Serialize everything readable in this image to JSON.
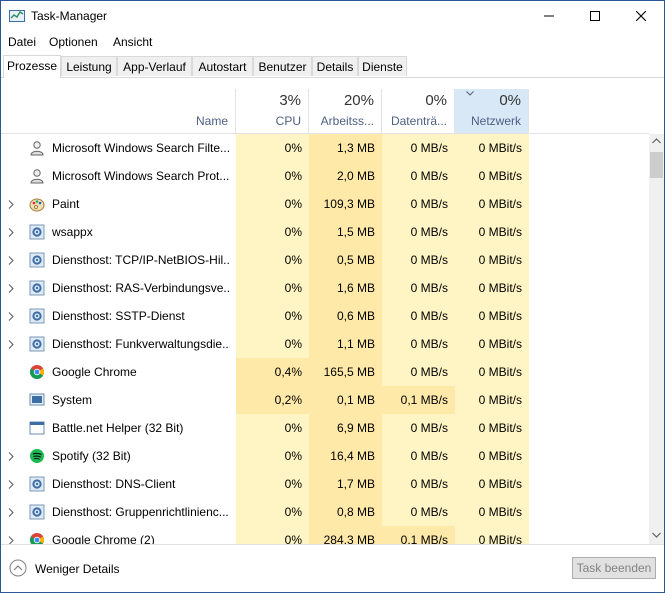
{
  "window": {
    "title": "Task-Manager"
  },
  "menu": [
    "Datei",
    "Optionen",
    "Ansicht"
  ],
  "tabs": [
    "Prozesse",
    "Leistung",
    "App-Verlauf",
    "Autostart",
    "Benutzer",
    "Details",
    "Dienste"
  ],
  "active_tab": "Prozesse",
  "columns": {
    "name": {
      "label": "Name"
    },
    "cpu": {
      "pct": "3%",
      "label": "CPU"
    },
    "mem": {
      "pct": "20%",
      "label": "Arbeitss..."
    },
    "disk": {
      "pct": "0%",
      "label": "Datenträ..."
    },
    "net": {
      "pct": "0%",
      "label": "Netzwerk"
    }
  },
  "rows": [
    {
      "name": "Microsoft Windows Search Filte...",
      "icon": "search-service-icon",
      "expandable": false,
      "cpu": "0%",
      "mem": "1,3 MB",
      "disk": "0 MB/s",
      "net": "0 MBit/s"
    },
    {
      "name": "Microsoft Windows Search Prot...",
      "icon": "search-service-icon",
      "expandable": false,
      "cpu": "0%",
      "mem": "2,0 MB",
      "disk": "0 MB/s",
      "net": "0 MBit/s"
    },
    {
      "name": "Paint",
      "icon": "paint-icon",
      "expandable": true,
      "cpu": "0%",
      "mem": "109,3 MB",
      "disk": "0 MB/s",
      "net": "0 MBit/s"
    },
    {
      "name": "wsappx",
      "icon": "gear-icon",
      "expandable": true,
      "cpu": "0%",
      "mem": "1,5 MB",
      "disk": "0 MB/s",
      "net": "0 MBit/s"
    },
    {
      "name": "Diensthost: TCP/IP-NetBIOS-Hil...",
      "icon": "gear-icon",
      "expandable": true,
      "cpu": "0%",
      "mem": "0,5 MB",
      "disk": "0 MB/s",
      "net": "0 MBit/s"
    },
    {
      "name": "Diensthost: RAS-Verbindungsve...",
      "icon": "gear-icon",
      "expandable": true,
      "cpu": "0%",
      "mem": "1,6 MB",
      "disk": "0 MB/s",
      "net": "0 MBit/s"
    },
    {
      "name": "Diensthost: SSTP-Dienst",
      "icon": "gear-icon",
      "expandable": true,
      "cpu": "0%",
      "mem": "0,6 MB",
      "disk": "0 MB/s",
      "net": "0 MBit/s"
    },
    {
      "name": "Diensthost: Funkverwaltungsdie...",
      "icon": "gear-icon",
      "expandable": true,
      "cpu": "0%",
      "mem": "1,1 MB",
      "disk": "0 MB/s",
      "net": "0 MBit/s"
    },
    {
      "name": "Google Chrome",
      "icon": "chrome-icon",
      "expandable": false,
      "cpu": "0,4%",
      "mem": "165,5 MB",
      "disk": "0 MB/s",
      "net": "0 MBit/s"
    },
    {
      "name": "System",
      "icon": "system-icon",
      "expandable": false,
      "cpu": "0,2%",
      "mem": "0,1 MB",
      "disk": "0,1 MB/s",
      "net": "0 MBit/s"
    },
    {
      "name": "Battle.net Helper (32 Bit)",
      "icon": "app-window-icon",
      "expandable": false,
      "cpu": "0%",
      "mem": "6,9 MB",
      "disk": "0 MB/s",
      "net": "0 MBit/s"
    },
    {
      "name": "Spotify (32 Bit)",
      "icon": "spotify-icon",
      "expandable": true,
      "cpu": "0%",
      "mem": "16,4 MB",
      "disk": "0 MB/s",
      "net": "0 MBit/s"
    },
    {
      "name": "Diensthost: DNS-Client",
      "icon": "gear-icon",
      "expandable": true,
      "cpu": "0%",
      "mem": "1,7 MB",
      "disk": "0 MB/s",
      "net": "0 MBit/s"
    },
    {
      "name": "Diensthost: Gruppenrichtlinienc...",
      "icon": "gear-icon",
      "expandable": true,
      "cpu": "0%",
      "mem": "0,8 MB",
      "disk": "0 MB/s",
      "net": "0 MBit/s"
    },
    {
      "name": "Google Chrome (2)",
      "icon": "chrome-icon",
      "expandable": true,
      "cpu": "0%",
      "mem": "284,3 MB",
      "disk": "0,1 MB/s",
      "net": "0 MBit/s"
    }
  ],
  "footer": {
    "fewer_details": "Weniger Details",
    "end_task": "Task beenden"
  },
  "colors": {
    "heat_low": "#fff4c4",
    "heat_mid": "#ffe9a8",
    "sorted_header": "#d9e8f7",
    "window_border": "#2b5797"
  }
}
